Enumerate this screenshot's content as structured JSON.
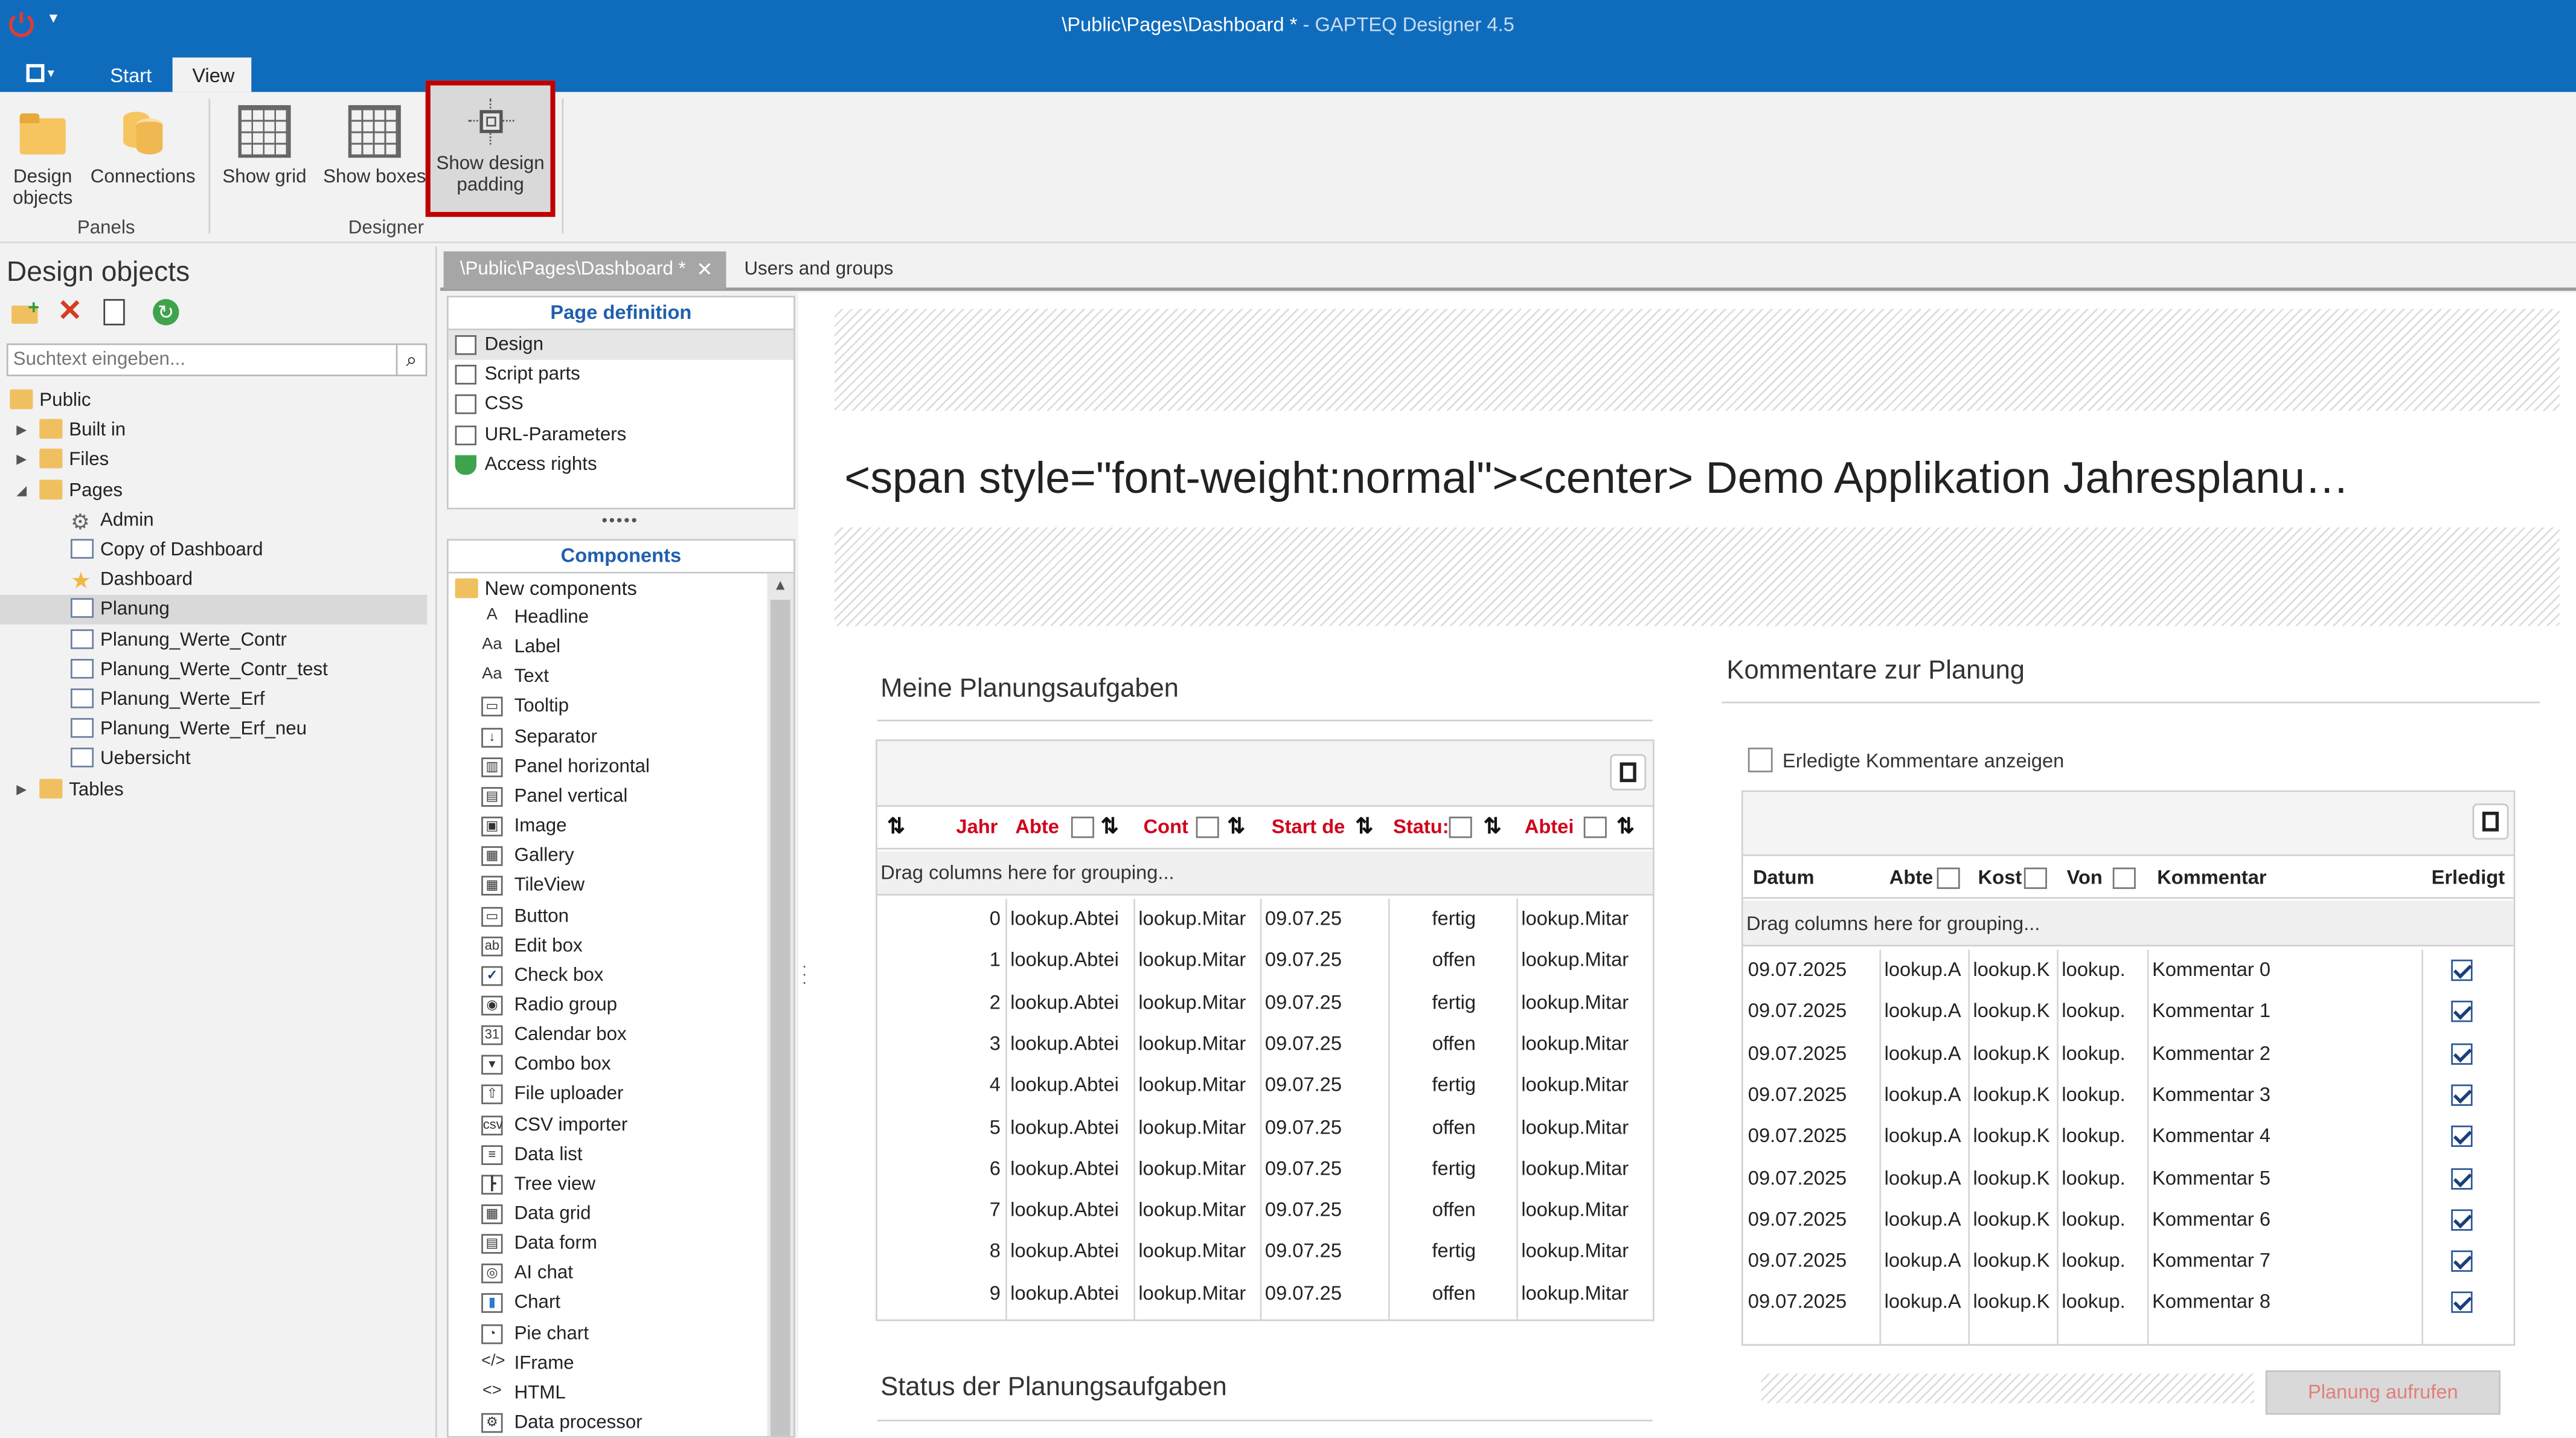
{
  "window": {
    "title": "\\Public\\Pages\\Dashboard *",
    "title_suffix": " - GAPTEQ Designer 4.5"
  },
  "ribbon": {
    "tabs": [
      "Start",
      "View"
    ],
    "active_tab": "View",
    "buttons": {
      "design_objects": "Design objects",
      "connections": "Connections",
      "show_grid": "Show grid",
      "show_boxes": "Show boxes",
      "show_design_padding": "Show design padding"
    },
    "groups": {
      "panels": "Panels",
      "designer": "Designer"
    }
  },
  "left_panel": {
    "title": "Design objects",
    "search_placeholder": "Suchtext eingeben...",
    "tree": [
      {
        "label": "Public",
        "level": 0,
        "type": "folder-open"
      },
      {
        "label": "Built in",
        "level": 1,
        "type": "folder"
      },
      {
        "label": "Files",
        "level": 1,
        "type": "folder"
      },
      {
        "label": "Pages",
        "level": 1,
        "type": "folder-open"
      },
      {
        "label": "Admin",
        "level": 2,
        "type": "gear"
      },
      {
        "label": "Copy of Dashboard",
        "level": 2,
        "type": "page"
      },
      {
        "label": "Dashboard",
        "level": 2,
        "type": "star"
      },
      {
        "label": "Planung",
        "level": 2,
        "type": "page",
        "selected": true
      },
      {
        "label": "Planung_Werte_Contr",
        "level": 2,
        "type": "page"
      },
      {
        "label": "Planung_Werte_Contr_test",
        "level": 2,
        "type": "page"
      },
      {
        "label": "Planung_Werte_Erf",
        "level": 2,
        "type": "page"
      },
      {
        "label": "Planung_Werte_Erf_neu",
        "level": 2,
        "type": "page"
      },
      {
        "label": "Uebersicht",
        "level": 2,
        "type": "page"
      },
      {
        "label": "Tables",
        "level": 1,
        "type": "folder"
      }
    ]
  },
  "doc_tabs": [
    {
      "label": "\\Public\\Pages\\Dashboard *",
      "active": true
    },
    {
      "label": "Users and groups",
      "active": false
    }
  ],
  "page_definition": {
    "title": "Page definition",
    "items": [
      "Design",
      "Script parts",
      "CSS",
      "URL-Parameters",
      "Access rights"
    ],
    "icons": [
      "design-icon",
      "script-icon",
      "css-icon",
      "url-icon",
      "shield-icon"
    ]
  },
  "components": {
    "title": "Components",
    "folder": "New components",
    "items": [
      {
        "label": "Headline",
        "glyph": "A"
      },
      {
        "label": "Label",
        "glyph": "Aa"
      },
      {
        "label": "Text",
        "glyph": "Aa"
      },
      {
        "label": "Tooltip",
        "glyph": "▭"
      },
      {
        "label": "Separator",
        "glyph": "↓"
      },
      {
        "label": "Panel horizontal",
        "glyph": "▥"
      },
      {
        "label": "Panel vertical",
        "glyph": "▤"
      },
      {
        "label": "Image",
        "glyph": "▣"
      },
      {
        "label": "Gallery",
        "glyph": "▦"
      },
      {
        "label": "TileView",
        "glyph": "▦"
      },
      {
        "label": "Button",
        "glyph": "▭"
      },
      {
        "label": "Edit box",
        "glyph": "ab"
      },
      {
        "label": "Check box",
        "glyph": "✓"
      },
      {
        "label": "Radio group",
        "glyph": "◉"
      },
      {
        "label": "Calendar box",
        "glyph": "31"
      },
      {
        "label": "Combo box",
        "glyph": "▾"
      },
      {
        "label": "File uploader",
        "glyph": "⇧"
      },
      {
        "label": "CSV importer",
        "glyph": "csv"
      },
      {
        "label": "Data list",
        "glyph": "≡"
      },
      {
        "label": "Tree view",
        "glyph": "┣"
      },
      {
        "label": "Data grid",
        "glyph": "▦"
      },
      {
        "label": "Data form",
        "glyph": "▤"
      },
      {
        "label": "AI chat",
        "glyph": "◎"
      },
      {
        "label": "Chart",
        "glyph": "▮"
      },
      {
        "label": "Pie chart",
        "glyph": "◔"
      },
      {
        "label": "IFrame",
        "glyph": "</>"
      },
      {
        "label": "HTML",
        "glyph": "<>"
      },
      {
        "label": "Data processor",
        "glyph": "⚙"
      }
    ]
  },
  "canvas": {
    "headline": "<span  style=\"font-weight:normal\"><center>  Demo  Applikation  Jahresplanu…",
    "left_section": {
      "title": "Meine Planungsaufgaben",
      "grid_headers": [
        "Jahr",
        "Abte",
        "Cont",
        "Start de",
        "Statu:",
        "Abtei"
      ],
      "group_hint": "Drag columns here for grouping...",
      "rows": [
        [
          "0",
          "lookup.Abtei",
          "lookup.Mitar",
          "09.07.25",
          "fertig",
          "lookup.Mitar"
        ],
        [
          "1",
          "lookup.Abtei",
          "lookup.Mitar",
          "09.07.25",
          "offen",
          "lookup.Mitar"
        ],
        [
          "2",
          "lookup.Abtei",
          "lookup.Mitar",
          "09.07.25",
          "fertig",
          "lookup.Mitar"
        ],
        [
          "3",
          "lookup.Abtei",
          "lookup.Mitar",
          "09.07.25",
          "offen",
          "lookup.Mitar"
        ],
        [
          "4",
          "lookup.Abtei",
          "lookup.Mitar",
          "09.07.25",
          "fertig",
          "lookup.Mitar"
        ],
        [
          "5",
          "lookup.Abtei",
          "lookup.Mitar",
          "09.07.25",
          "offen",
          "lookup.Mitar"
        ],
        [
          "6",
          "lookup.Abtei",
          "lookup.Mitar",
          "09.07.25",
          "fertig",
          "lookup.Mitar"
        ],
        [
          "7",
          "lookup.Abtei",
          "lookup.Mitar",
          "09.07.25",
          "offen",
          "lookup.Mitar"
        ],
        [
          "8",
          "lookup.Abtei",
          "lookup.Mitar",
          "09.07.25",
          "fertig",
          "lookup.Mitar"
        ],
        [
          "9",
          "lookup.Abtei",
          "lookup.Mitar",
          "09.07.25",
          "offen",
          "lookup.Mitar"
        ]
      ],
      "status_title": "Status der  Planungsaufgaben"
    },
    "right_section": {
      "title": "Kommentare zur Planung",
      "checkbox_label": "Erledigte Kommentare anzeigen",
      "grid_headers": [
        "Datum",
        "Abte",
        "Kost",
        "Von",
        "Kommentar",
        "Erledigt"
      ],
      "group_hint": "Drag columns here for grouping...",
      "rows": [
        [
          "09.07.2025",
          "lookup.A",
          "lookup.K",
          "lookup.",
          "Kommentar 0"
        ],
        [
          "09.07.2025",
          "lookup.A",
          "lookup.K",
          "lookup.",
          "Kommentar 1"
        ],
        [
          "09.07.2025",
          "lookup.A",
          "lookup.K",
          "lookup.",
          "Kommentar 2"
        ],
        [
          "09.07.2025",
          "lookup.A",
          "lookup.K",
          "lookup.",
          "Kommentar 3"
        ],
        [
          "09.07.2025",
          "lookup.A",
          "lookup.K",
          "lookup.",
          "Kommentar 4"
        ],
        [
          "09.07.2025",
          "lookup.A",
          "lookup.K",
          "lookup.",
          "Kommentar 5"
        ],
        [
          "09.07.2025",
          "lookup.A",
          "lookup.K",
          "lookup.",
          "Kommentar 6"
        ],
        [
          "09.07.2025",
          "lookup.A",
          "lookup.K",
          "lookup.",
          "Kommentar 7"
        ],
        [
          "09.07.2025",
          "lookup.A",
          "lookup.K",
          "lookup.",
          "Kommentar 8"
        ]
      ],
      "button_label": "Planung aufrufen"
    }
  },
  "colors": {
    "titlebar": "#0f6cbd",
    "header_text": "#d0021b",
    "highlight_border": "#c00000",
    "section_title_blue": "#1f5fae"
  }
}
